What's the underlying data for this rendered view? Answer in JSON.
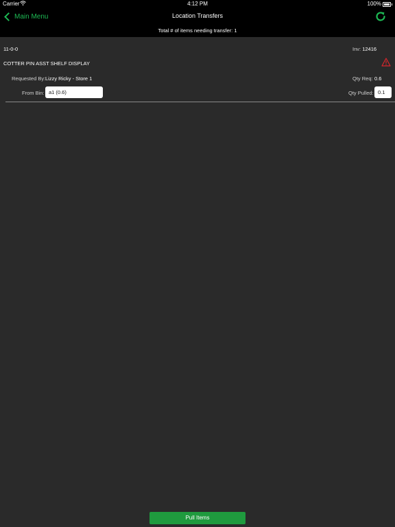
{
  "status_bar": {
    "carrier": "Carrier",
    "time": "4:12 PM",
    "battery": "100%"
  },
  "nav": {
    "back_label": "Main Menu",
    "title": "Location Transfers",
    "subtitle": "Total # of items needing transfer: 1"
  },
  "item": {
    "code": "11-0-0",
    "inv_label": "Inv:",
    "inv_value": "12416",
    "description": "COTTER PIN ASST SHELF DISPLAY",
    "requested_by_label": "Requested By:",
    "requested_by_value": "Lizzy Ricky - Store 1",
    "qty_req_label": "Qty Req:",
    "qty_req_value": "0.6",
    "from_bin_label": "From Bin:",
    "from_bin_value": "a1 (0.6)",
    "qty_pulled_label": "Qty Pulled:",
    "qty_pulled_value": "0.1"
  },
  "footer": {
    "pull_button_label": "Pull Items"
  },
  "colors": {
    "accent": "#1db954",
    "warning": "#d9262c",
    "button": "#1f9a3e",
    "background": "#2a2a2a"
  }
}
